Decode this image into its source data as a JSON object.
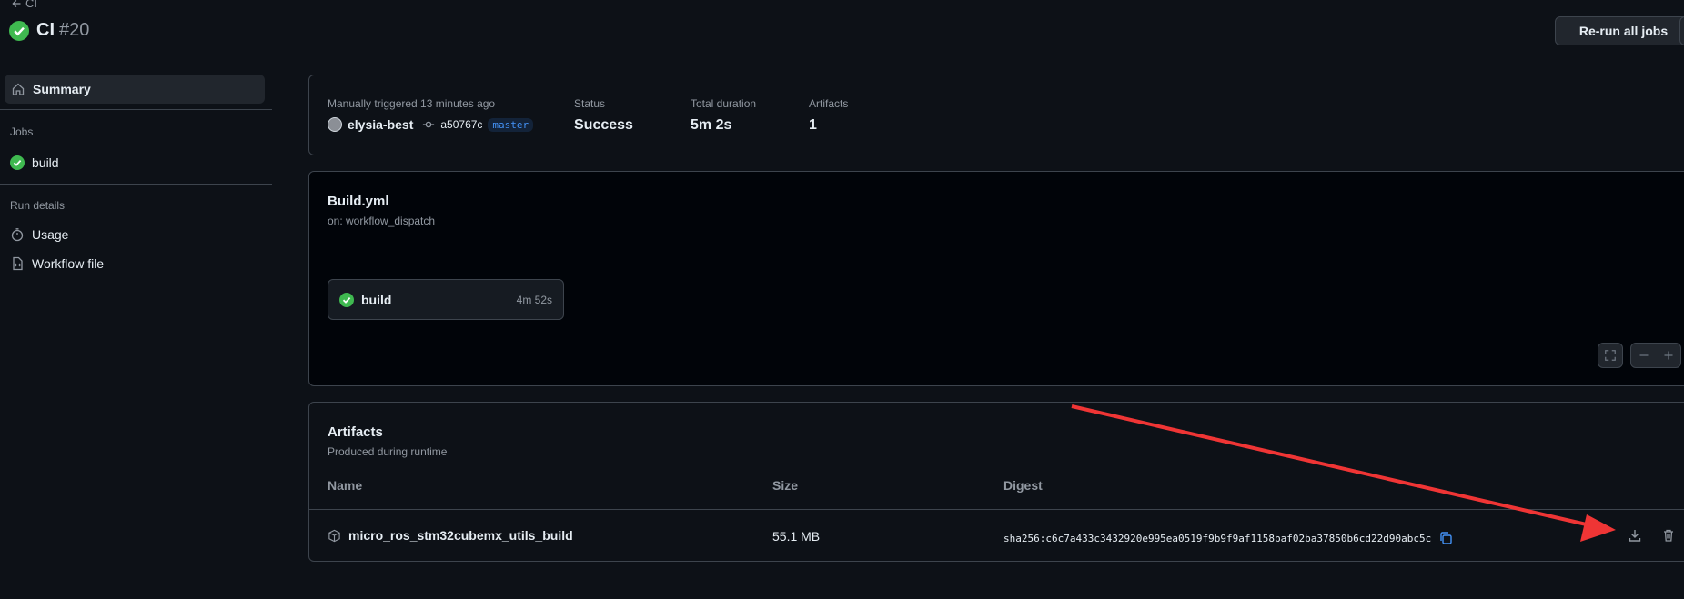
{
  "header": {
    "back_label": "CI",
    "title": "CI",
    "run_number": "#20",
    "rerun_label": "Re-run all jobs"
  },
  "sidebar": {
    "summary_label": "Summary",
    "jobs_heading": "Jobs",
    "jobs": [
      {
        "label": "build"
      }
    ],
    "run_details_heading": "Run details",
    "usage_label": "Usage",
    "workflow_file_label": "Workflow file"
  },
  "summary": {
    "trigger_text": "Manually triggered 13 minutes ago",
    "actor": "elysia-best",
    "commit": "a50767c",
    "branch": "master",
    "status_label": "Status",
    "status_value": "Success",
    "duration_label": "Total duration",
    "duration_value": "5m 2s",
    "artifacts_label": "Artifacts",
    "artifacts_value": "1"
  },
  "workflow": {
    "name": "Build.yml",
    "trigger": "on: workflow_dispatch",
    "job_name": "build",
    "job_duration": "4m 52s"
  },
  "artifacts": {
    "title": "Artifacts",
    "subtitle": "Produced during runtime",
    "columns": [
      "Name",
      "Size",
      "Digest"
    ],
    "rows": [
      {
        "name": "micro_ros_stm32cubemx_utils_build",
        "size": "55.1 MB",
        "digest": "sha256:c6c7a433c3432920e995ea0519f9b9f9af1158baf02ba37850b6cd22d90abc5c"
      }
    ]
  },
  "colors": {
    "success": "#3fb950",
    "accent": "#4493f8",
    "annotation_arrow": "#ef3535"
  }
}
